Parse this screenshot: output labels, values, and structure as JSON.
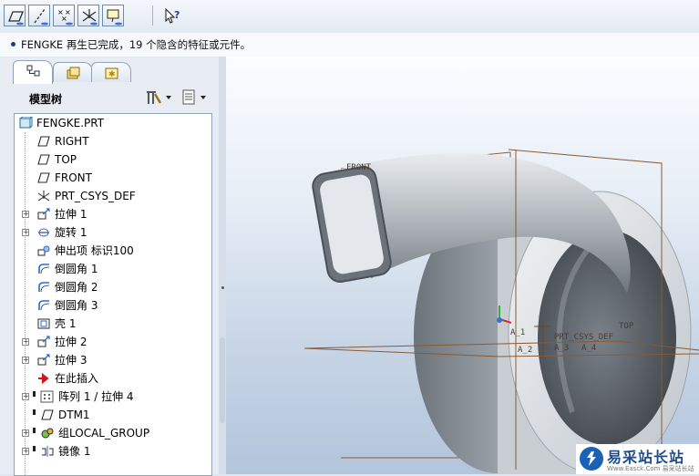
{
  "toolbar": {
    "buttons": [
      "datum-plane-display",
      "datum-axis-display",
      "datum-point-display",
      "coordinate-system-display",
      "annotation-display"
    ],
    "whats_this": "help-pointer"
  },
  "message": {
    "text": "FENGKE 再生已完成，19 个隐含的特征或元件。"
  },
  "left_panel": {
    "tree_title": "模型树",
    "tabs": [
      "model-tree",
      "folder-browser",
      "favorites"
    ]
  },
  "model_tree": {
    "root": "FENGKE.PRT",
    "items": [
      {
        "label": "RIGHT",
        "icon": "datum-plane-icon",
        "expandable": false,
        "flag": false
      },
      {
        "label": "TOP",
        "icon": "datum-plane-icon",
        "expandable": false,
        "flag": false
      },
      {
        "label": "FRONT",
        "icon": "datum-plane-icon",
        "expandable": false,
        "flag": false
      },
      {
        "label": "PRT_CSYS_DEF",
        "icon": "coordinate-system-icon",
        "expandable": false,
        "flag": false
      },
      {
        "label": "拉伸 1",
        "icon": "extrude-icon",
        "expandable": true,
        "flag": false
      },
      {
        "label": "旋转 1",
        "icon": "revolve-icon",
        "expandable": true,
        "flag": false
      },
      {
        "label": "伸出项 标识100",
        "icon": "protrusion-icon",
        "expandable": false,
        "flag": false
      },
      {
        "label": "倒圆角 1",
        "icon": "round-icon",
        "expandable": false,
        "flag": false
      },
      {
        "label": "倒圆角 2",
        "icon": "round-icon",
        "expandable": false,
        "flag": false
      },
      {
        "label": "倒圆角 3",
        "icon": "round-icon",
        "expandable": false,
        "flag": false
      },
      {
        "label": "壳 1",
        "icon": "shell-icon",
        "expandable": false,
        "flag": false
      },
      {
        "label": "拉伸 2",
        "icon": "extrude-icon",
        "expandable": true,
        "flag": false
      },
      {
        "label": "拉伸 3",
        "icon": "extrude-icon",
        "expandable": true,
        "flag": false
      },
      {
        "label": "在此插入",
        "icon": "insert-here-arrow-icon",
        "expandable": false,
        "flag": false
      },
      {
        "label": "阵列 1 / 拉伸 4",
        "icon": "pattern-icon",
        "expandable": true,
        "flag": true
      },
      {
        "label": "DTM1",
        "icon": "datum-plane-icon",
        "expandable": false,
        "flag": true
      },
      {
        "label": "组LOCAL_GROUP",
        "icon": "group-icon",
        "expandable": true,
        "flag": true
      },
      {
        "label": "镜像 1",
        "icon": "mirror-icon",
        "expandable": true,
        "flag": true
      }
    ]
  },
  "viewport": {
    "datum_labels": {
      "front": "FRONT",
      "top": "TOP",
      "csys": "PRT_CSYS_DEF",
      "axis1": "A_1",
      "axis2": "A_2",
      "axis3": "A_3",
      "axis4": "A_4"
    }
  },
  "watermark": {
    "title": "易采站长站",
    "subtitle": "Www.Easck.Com  易采站长站"
  }
}
